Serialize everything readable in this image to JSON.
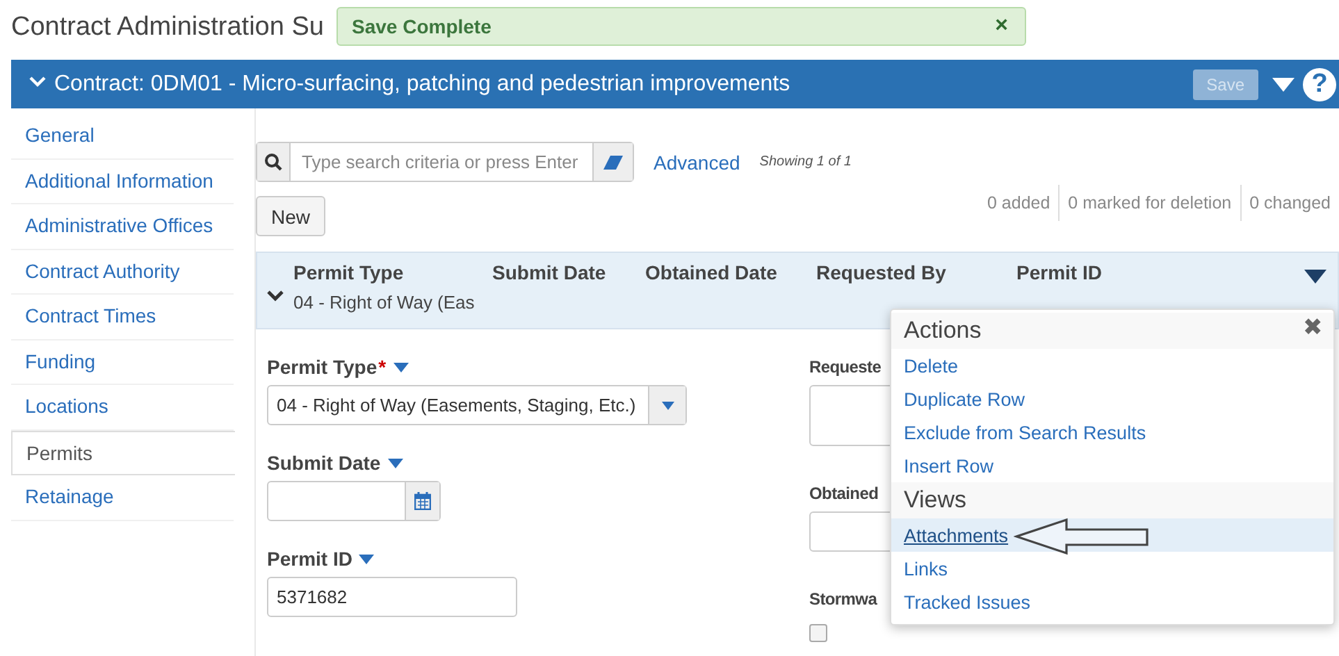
{
  "page_title": "Contract Administration Su",
  "toast": {
    "message": "Save Complete",
    "close": "×"
  },
  "header": {
    "expanded": true,
    "title": "Contract: 0DM01 - Micro-surfacing, patching and pedestrian improvements",
    "save_button": {
      "label": "Save",
      "disabled": true
    },
    "help": "?"
  },
  "sidebar": {
    "items": [
      {
        "label": "General",
        "selected": false
      },
      {
        "label": "Additional Information",
        "selected": false
      },
      {
        "label": "Administrative Offices",
        "selected": false
      },
      {
        "label": "Contract Authority",
        "selected": false
      },
      {
        "label": "Contract Times",
        "selected": false
      },
      {
        "label": "Funding",
        "selected": false
      },
      {
        "label": "Locations",
        "selected": false
      },
      {
        "label": "Permits",
        "selected": true
      },
      {
        "label": "Retainage",
        "selected": false
      }
    ]
  },
  "search": {
    "placeholder": "Type search criteria or press Enter",
    "advanced": "Advanced",
    "showing": "Showing 1 of 1"
  },
  "new_button": "New",
  "counters": [
    "0 added",
    "0 marked for deletion",
    "0 changed"
  ],
  "grid": {
    "columns": [
      "Permit Type",
      "Submit Date",
      "Obtained Date",
      "Requested By",
      "Permit ID"
    ],
    "row": {
      "expanded": true,
      "cells": [
        "04 - Right of Way (Eas"
      ]
    }
  },
  "form": {
    "left": [
      {
        "kind": "select",
        "label": "Permit Type",
        "required_mark": "*",
        "value": "04 - Right of Way (Easements, Staging, Etc.)"
      },
      {
        "kind": "date",
        "label": "Submit Date"
      },
      {
        "kind": "text",
        "label": "Permit ID",
        "value": "5371682"
      }
    ],
    "right": [
      {
        "kind": "textarea",
        "label": "Requeste"
      },
      {
        "kind": "text",
        "label": "Obtained"
      },
      {
        "kind": "checkbox",
        "label": "Stormwa",
        "checked": false
      }
    ]
  },
  "menu": {
    "close": "✖",
    "sections": [
      {
        "title": "Actions",
        "items": [
          {
            "label": "Delete",
            "selected": false
          },
          {
            "label": "Duplicate Row",
            "selected": false
          },
          {
            "label": "Exclude from Search Results",
            "selected": false
          },
          {
            "label": "Insert Row",
            "selected": false
          }
        ]
      },
      {
        "title": "Views",
        "items": [
          {
            "label": "Attachments",
            "selected": true
          },
          {
            "label": "Links",
            "selected": false
          },
          {
            "label": "Tracked Issues",
            "selected": false
          }
        ]
      }
    ]
  }
}
